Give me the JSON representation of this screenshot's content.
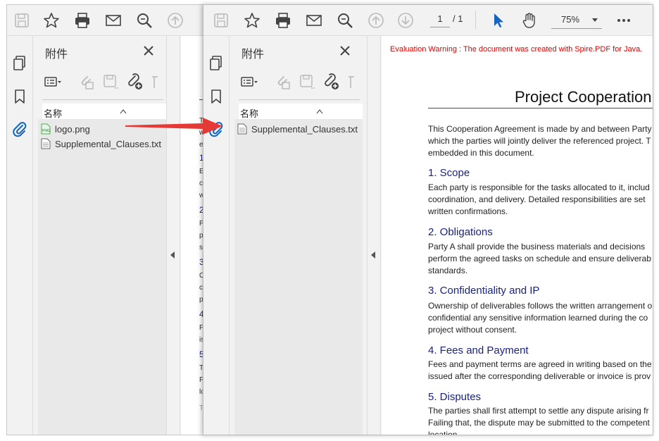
{
  "colors": {
    "accent_blue": "#1565c0",
    "warning_red": "#e00000",
    "heading_navy": "#1a237e",
    "arrow_red": "#e53935"
  },
  "toolbar": {
    "page_current": "1",
    "page_total": "/ 1",
    "zoom": "75%",
    "icons": [
      "save-icon",
      "star-icon",
      "print-icon",
      "mail-icon",
      "zoom-search-icon",
      "arrow-up-circle-icon",
      "arrow-down-circle-icon",
      "select-cursor-icon",
      "hand-pan-icon",
      "more-icon"
    ]
  },
  "rail": {
    "icons": [
      "pages-icon",
      "bookmark-icon",
      "paperclip-icon"
    ]
  },
  "attachments_back": {
    "title": "附件",
    "column_name": "名称",
    "files": [
      {
        "name": "logo.png",
        "icon": "png-file-icon"
      },
      {
        "name": "Supplemental_Clauses.txt",
        "icon": "text-file-icon"
      }
    ]
  },
  "attachments_front": {
    "title": "附件",
    "column_name": "名称",
    "files": [
      {
        "name": "Supplemental_Clauses.txt",
        "icon": "text-file-icon"
      }
    ]
  },
  "back_page": {
    "fragments": [
      {
        "kind": "h",
        "text": "1"
      },
      {
        "kind": "p",
        "text": "E"
      },
      {
        "kind": "p",
        "text": "c"
      },
      {
        "kind": "p",
        "text": "w"
      },
      {
        "kind": "h",
        "text": "2"
      },
      {
        "kind": "p",
        "text": "P"
      },
      {
        "kind": "p",
        "text": "p"
      },
      {
        "kind": "p",
        "text": "st"
      },
      {
        "kind": "h",
        "text": "3"
      },
      {
        "kind": "p",
        "text": "O"
      },
      {
        "kind": "p",
        "text": "c"
      },
      {
        "kind": "p",
        "text": "pr"
      },
      {
        "kind": "h",
        "text": "4"
      },
      {
        "kind": "p",
        "text": "F"
      },
      {
        "kind": "p",
        "text": "is"
      },
      {
        "kind": "h",
        "text": "5"
      },
      {
        "kind": "p",
        "text": "T"
      },
      {
        "kind": "p",
        "text": "F"
      },
      {
        "kind": "p",
        "text": "lo"
      },
      {
        "kind": "p",
        "text": "T"
      }
    ],
    "top_lines": [
      "T",
      "w",
      "e"
    ]
  },
  "document": {
    "warning": "Evaluation Warning : The document was created with Spire.PDF for Java.",
    "title": "Project Cooperation",
    "intro": [
      "This Cooperation Agreement is made by and between Party",
      "which the parties will jointly deliver the referenced project. T",
      "embedded in this document."
    ],
    "sections": [
      {
        "heading": "1. Scope",
        "lines": [
          "Each party is responsible for the tasks allocated to it, includ",
          "coordination, and delivery. Detailed responsibilities are set",
          "written confirmations."
        ]
      },
      {
        "heading": "2. Obligations",
        "lines": [
          "Party A shall provide the business materials and decisions",
          "perform the agreed tasks on schedule and ensure deliverab",
          "standards."
        ]
      },
      {
        "heading": "3. Confidentiality and IP",
        "lines": [
          "Ownership of deliverables follows the written arrangement o",
          "confidential any sensitive information learned during the co",
          "project without consent."
        ]
      },
      {
        "heading": "4. Fees and Payment",
        "lines": [
          "Fees and payment terms are agreed in writing based on the",
          "issued after the corresponding deliverable or invoice is prov"
        ]
      },
      {
        "heading": "5. Disputes",
        "lines": [
          "The parties shall first attempt to settle any dispute arising fr",
          "Failing that, the dispute may be submitted to the competent",
          "location."
        ]
      }
    ]
  }
}
